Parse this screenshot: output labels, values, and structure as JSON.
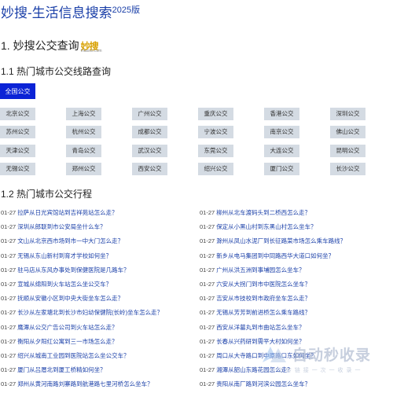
{
  "header": {
    "title": "妙搜-生活信息搜索",
    "version": "2025版"
  },
  "section1": {
    "heading": "1. 妙搜公交查询",
    "logo_text": "妙搜",
    "logo_sub": "miaoso.com"
  },
  "section1_1": {
    "heading": "1.1 热门城市公交线路查询",
    "national_button": "全国公交",
    "cities": [
      "北京公交",
      "上海公交",
      "广州公交",
      "重庆公交",
      "香港公交",
      "深圳公交",
      "苏州公交",
      "杭州公交",
      "成都公交",
      "宁波公交",
      "南京公交",
      "佛山公交",
      "天津公交",
      "青岛公交",
      "武汉公交",
      "东莞公交",
      "大连公交",
      "昆明公交",
      "无锡公交",
      "郑州公交",
      "西安公交",
      "绍兴公交",
      "厦门公交",
      "长沙公交"
    ]
  },
  "section1_2": {
    "heading": "1.2 热门城市公交行程",
    "left_items": [
      {
        "date": "01-27",
        "text": "拉萨从日光宾馆站到吉祥苑站怎么走？"
      },
      {
        "date": "01-27",
        "text": "深圳从郎联到市公安局坐什么车？"
      },
      {
        "date": "01-27",
        "text": "文山从北京西市场到市一中大门怎么走？"
      },
      {
        "date": "01-27",
        "text": "无锡从东山新村到育才学校如何坐？"
      },
      {
        "date": "01-27",
        "text": "驻马店从东风办事处到保健医院是几路车？"
      },
      {
        "date": "01-27",
        "text": "宣城从绵阳到火车站怎么坐公交车？"
      },
      {
        "date": "01-27",
        "text": "抚顺从安徽小区到中央大街坐车怎么走？"
      },
      {
        "date": "01-27",
        "text": "长沙从左家塘北到长沙市妇幼保健院(长岭)坐车怎么走？"
      },
      {
        "date": "01-27",
        "text": "鹰潭从公交广告公司到火车站怎么走？"
      },
      {
        "date": "01-27",
        "text": "衡阳从夕阳红公寓到三一市场怎么走？"
      },
      {
        "date": "01-27",
        "text": "绍兴从城南工业园到医院站怎么坐公交车？"
      },
      {
        "date": "01-27",
        "text": "厦门从吕厝北到厦工桥精如何坐？"
      },
      {
        "date": "01-27",
        "text": "郑州从黄河南路刘寨路到航港路七里河桥怎么坐车？"
      }
    ],
    "right_items": [
      {
        "date": "01-27",
        "text": "柳州从北车渡码头到二桥西怎么走？"
      },
      {
        "date": "01-27",
        "text": "保定从小黑山村到东黑山村怎么坐车？"
      },
      {
        "date": "01-27",
        "text": "滁州从凤山水泥厂到长征路菜市场怎么乘车路线？"
      },
      {
        "date": "01-27",
        "text": "新乡从电马集团到中同路西华大道口如何坐？"
      },
      {
        "date": "01-27",
        "text": "广州从洪五洲到事埔园怎么坐车？"
      },
      {
        "date": "01-27",
        "text": "六安从大拐门到市中医院怎么坐车？"
      },
      {
        "date": "01-27",
        "text": "吉安从市技校到市政府坐车怎么走？"
      },
      {
        "date": "01-27",
        "text": "无锡从芳芳到前进桥怎么乘车路线？"
      },
      {
        "date": "01-27",
        "text": "西安从洋墓丸到市曲站怎么坐车？"
      },
      {
        "date": "01-27",
        "text": "长春从兴药研到需平大村如何坐？"
      },
      {
        "date": "01-27",
        "text": "周口从大寺路口到中原路口东如何坐？"
      },
      {
        "date": "01-27",
        "text": "湘潭从韶山东路花园怎么走？"
      },
      {
        "date": "01-27",
        "text": "贵阳从南厂路到河滨公园怎么坐车？"
      }
    ]
  },
  "watermark": {
    "text": "自动秒收录",
    "sub": "一 上 传 链 接 一 次 一 收 录 一"
  }
}
